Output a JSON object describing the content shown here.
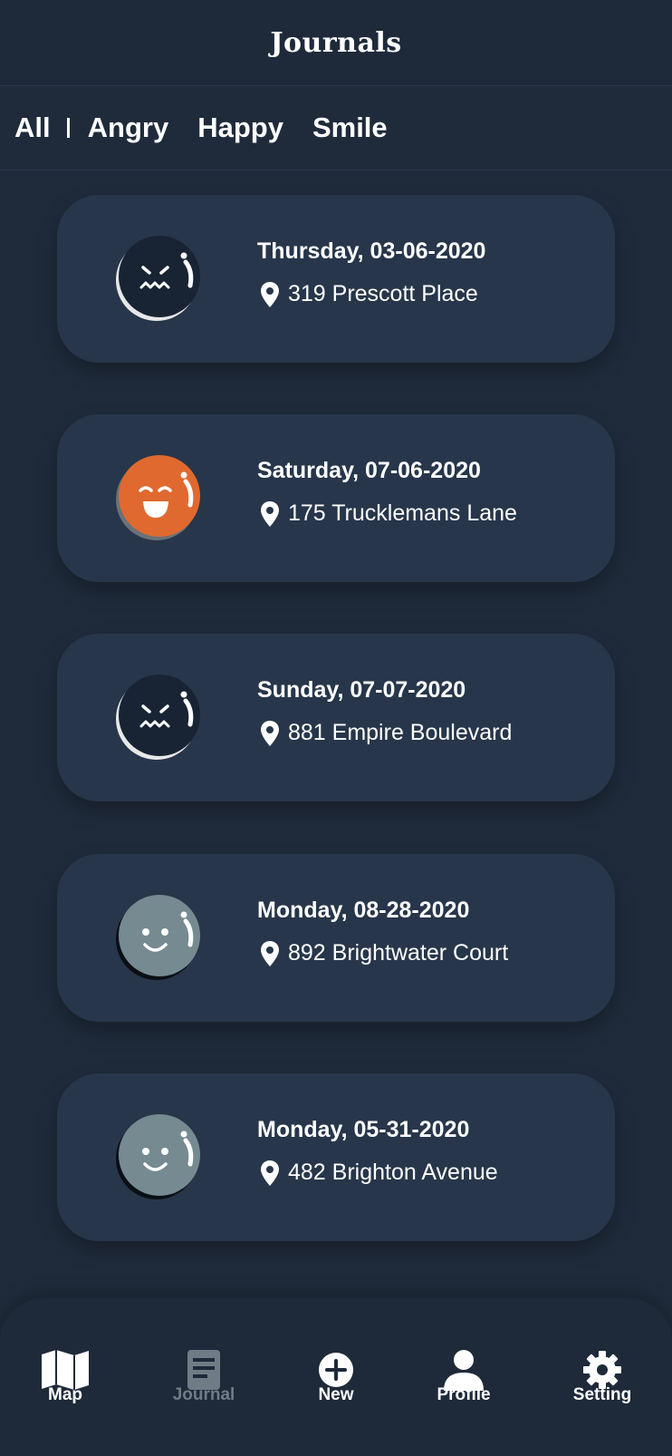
{
  "header": {
    "title": "Journals"
  },
  "filters": [
    {
      "label": "All"
    },
    {
      "label": "Angry"
    },
    {
      "label": "Happy"
    },
    {
      "label": "Smile"
    }
  ],
  "entries": [
    {
      "date": "Thursday, 03-06-2020",
      "location": "319 Prescott Place",
      "mood": "angry"
    },
    {
      "date": "Saturday, 07-06-2020",
      "location": "175 Trucklemans Lane",
      "mood": "happy"
    },
    {
      "date": "Sunday, 07-07-2020",
      "location": "881 Empire Boulevard",
      "mood": "angry"
    },
    {
      "date": "Monday, 08-28-2020",
      "location": "892 Brightwater Court",
      "mood": "smile"
    },
    {
      "date": "Monday, 05-31-2020",
      "location": "482 Brighton Avenue",
      "mood": "smile"
    }
  ],
  "tabbar": {
    "items": [
      {
        "label": "Map",
        "icon": "map-icon",
        "active": false
      },
      {
        "label": "Journal",
        "icon": "journal-icon",
        "active": true
      },
      {
        "label": "New",
        "icon": "plus-circle-icon",
        "active": false
      },
      {
        "label": "Profile",
        "icon": "person-icon",
        "active": false
      },
      {
        "label": "Setting",
        "icon": "gear-icon",
        "active": false
      }
    ]
  },
  "colors": {
    "background": "#1f2b3b",
    "card": "#27364a",
    "angry_face": "#182434",
    "happy_face": "#e0692f",
    "smile_face": "#768a91",
    "muted_tab": "#6f7c86"
  }
}
